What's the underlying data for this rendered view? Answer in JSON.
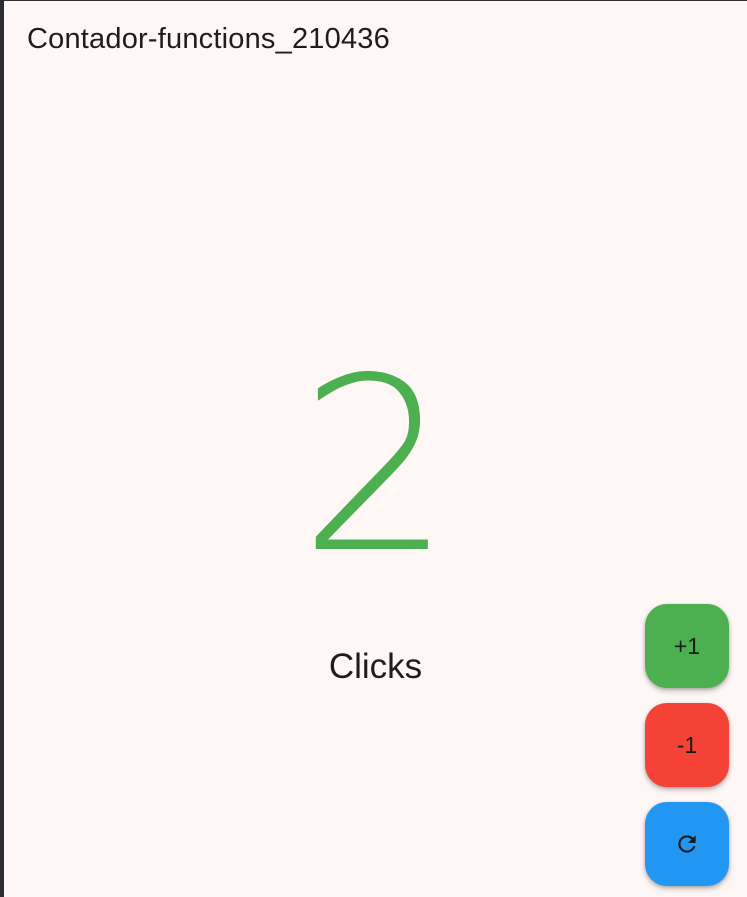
{
  "app": {
    "title": "Contador-functions_210436"
  },
  "counter": {
    "value": "2",
    "label": "Clicks",
    "value_color": "#4caf50"
  },
  "actions": {
    "increment_label": "+1",
    "decrement_label": "-1",
    "reset_icon": "refresh-icon",
    "increment_color": "#4caf50",
    "decrement_color": "#f44336",
    "reset_color": "#2196f3"
  }
}
